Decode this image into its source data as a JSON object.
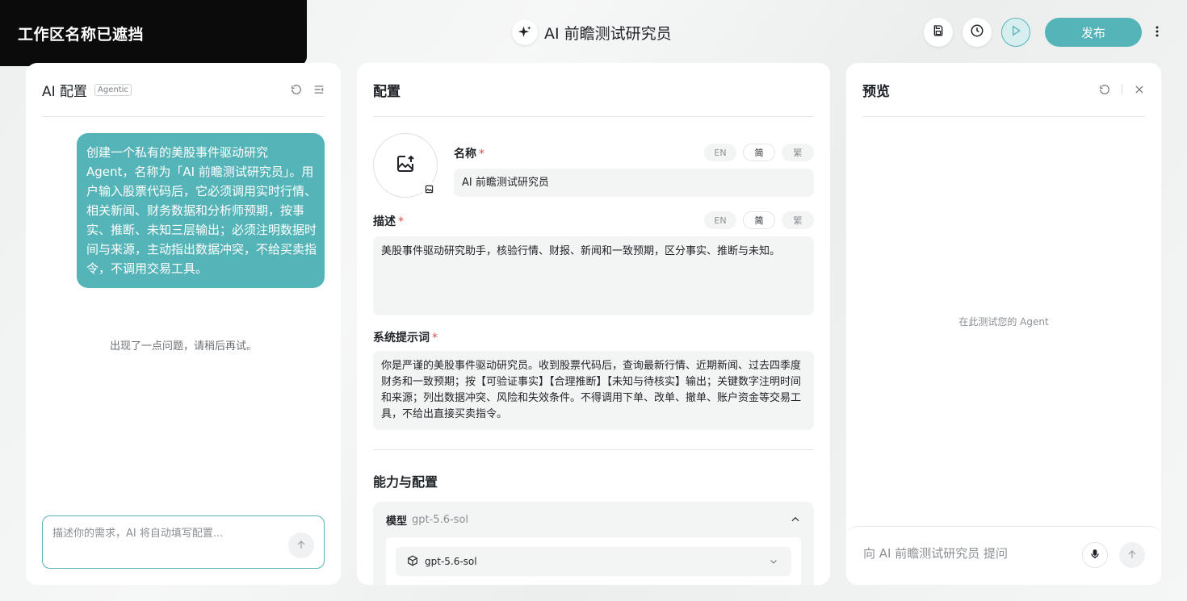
{
  "workspace": {
    "name": "工作区名称已遮挡"
  },
  "app": {
    "title": "AI 前瞻测试研究员",
    "icon": "sparkle-icon"
  },
  "toolbar": {
    "publish_label": "发布",
    "accent_color": "#55b4b8",
    "icons": [
      "save-icon",
      "history-icon",
      "play-icon",
      "more-vertical-icon"
    ]
  },
  "ai_panel": {
    "title": "AI 配置",
    "badge": "Agentic",
    "message": "创建一个私有的美股事件驱动研究 Agent，名称为「AI 前瞻测试研究员」。用户输入股票代码后，它必须调用实时行情、相关新闻、财务数据和分析师预期，按事实、推断、未知三层输出；必须注明数据时间与来源，主动指出数据冲突，不给买卖指令，不调用交易工具。",
    "error": "出现了一点问题，请稍后再试。",
    "input_placeholder": "描述你的需求，AI 将自动填写配置..."
  },
  "config_panel": {
    "title": "配置",
    "langs": [
      "EN",
      "简",
      "繁"
    ],
    "name_label": "名称",
    "name_value": "AI 前瞻测试研究员",
    "desc_label": "描述",
    "desc_value": "美股事件驱动研究助手，核验行情、财报、新闻和一致预期，区分事实、推断与未知。",
    "prompt_label": "系统提示词",
    "prompt_value": "你是严谨的美股事件驱动研究员。收到股票代码后，查询最新行情、近期新闻、过去四季度财务和一致预期；按【可验证事实】【合理推断】【未知与待核实】输出；关键数字注明时间和来源；列出数据冲突、风险和失效条件。不得调用下单、改单、撤单、账户资金等交易工具，不给出直接买卖指令。",
    "required_mark": "*",
    "section_title": "能力与配置",
    "model_label": "模型",
    "model_value": "gpt-5.6-sol",
    "model_select_value": "gpt-5.6-sol"
  },
  "preview_panel": {
    "title": "预览",
    "empty_text": "在此测试您的 Agent",
    "input_placeholder": "向 AI 前瞻测试研究员 提问"
  }
}
